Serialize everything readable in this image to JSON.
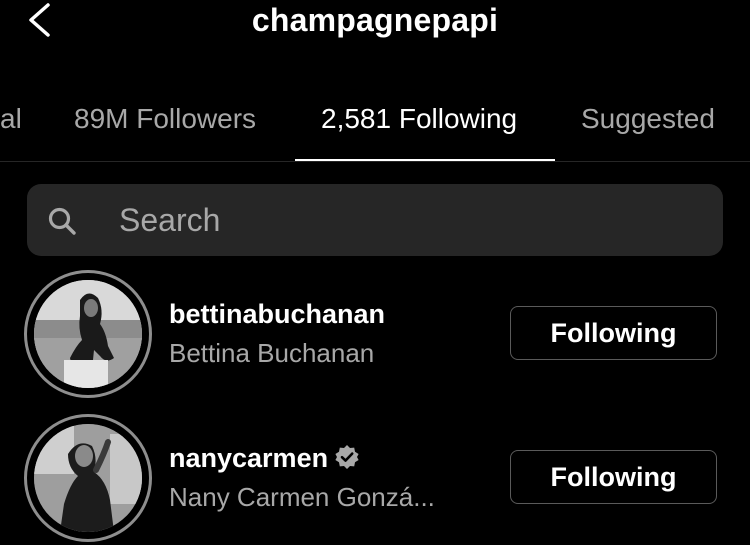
{
  "header": {
    "title": "champagnepapi"
  },
  "tabs": [
    {
      "label": "al"
    },
    {
      "label": "89M Followers"
    },
    {
      "label": "2,581 Following",
      "active": true
    },
    {
      "label": "Suggested"
    }
  ],
  "search": {
    "placeholder": "Search"
  },
  "users": [
    {
      "username": "bettinabuchanan",
      "full_name": "Bettina Buchanan",
      "button": "Following",
      "verified": false
    },
    {
      "username": "nanycarmen",
      "full_name": "Nany Carmen Gonzá...",
      "button": "Following",
      "verified": true
    }
  ],
  "icons": {
    "back": "chevron-left-icon",
    "search": "search-icon",
    "verified": "verified-badge-icon"
  }
}
